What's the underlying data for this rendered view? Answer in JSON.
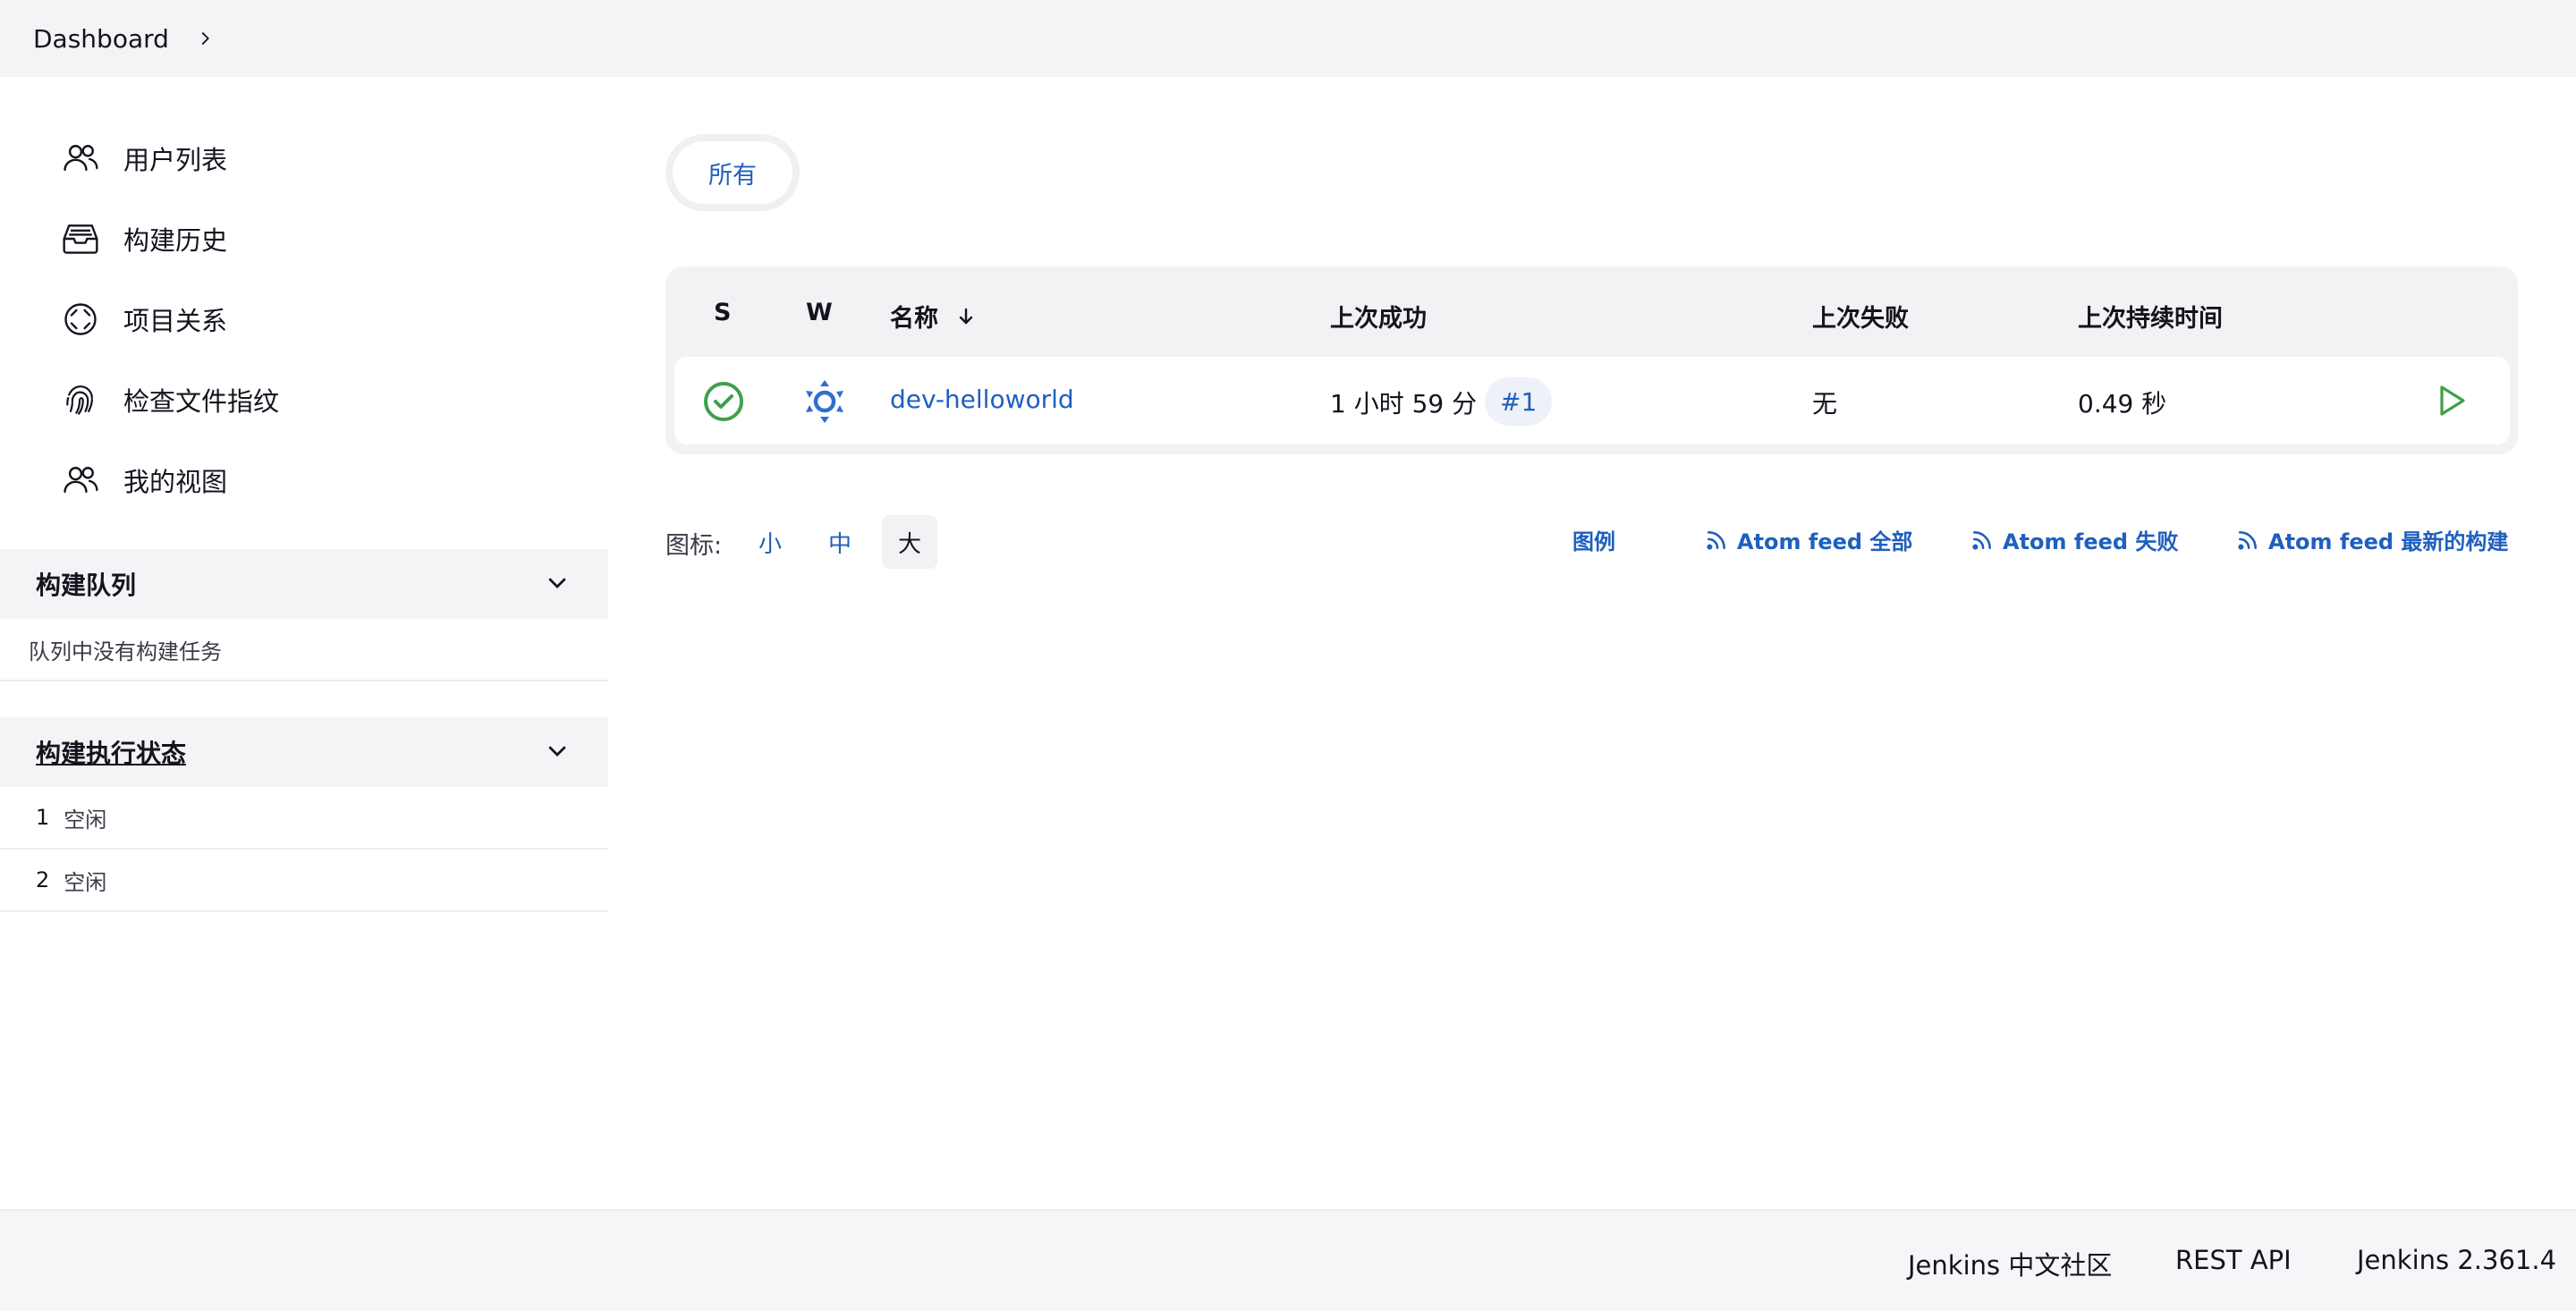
{
  "breadcrumb": {
    "dashboard": "Dashboard"
  },
  "sidebar": {
    "tasks": [
      {
        "label": "用户列表",
        "icon": "people-icon"
      },
      {
        "label": "构建历史",
        "icon": "inbox-tray-icon"
      },
      {
        "label": "项目关系",
        "icon": "focus-circle-icon"
      },
      {
        "label": "检查文件指纹",
        "icon": "fingerprint-icon"
      },
      {
        "label": "我的视图",
        "icon": "people-icon"
      }
    ],
    "queue": {
      "title": "构建队列",
      "empty_text": "队列中没有构建任务"
    },
    "executors": {
      "title": "构建执行状态",
      "items": [
        {
          "num": "1",
          "status": "空闲"
        },
        {
          "num": "2",
          "status": "空闲"
        }
      ]
    }
  },
  "tabs": {
    "all": "所有"
  },
  "table": {
    "headers": {
      "s": "S",
      "w": "W",
      "name": "名称",
      "last_success": "上次成功",
      "last_failure": "上次失败",
      "last_duration": "上次持续时间"
    },
    "rows": [
      {
        "name": "dev-helloworld",
        "last_success": "1 小时 59 分",
        "build": "#1",
        "last_failure": "无",
        "last_duration": "0.49 秒",
        "status_color": "#3fa14a",
        "weather_color": "#2f6fd0"
      }
    ]
  },
  "icon_size": {
    "label": "图标:",
    "small": "小",
    "medium": "中",
    "large": "大"
  },
  "links": {
    "legend": "图例",
    "feed_all": "Atom feed 全部",
    "feed_failed": "Atom feed 失败",
    "feed_latest": "Atom feed 最新的构建"
  },
  "footer": {
    "community": "Jenkins 中文社区",
    "rest_api": "REST API",
    "version": "Jenkins 2.361.4"
  },
  "colors": {
    "link": "#1f5fbf",
    "success": "#3fa14a",
    "panel_bg": "#f4f4f6"
  }
}
